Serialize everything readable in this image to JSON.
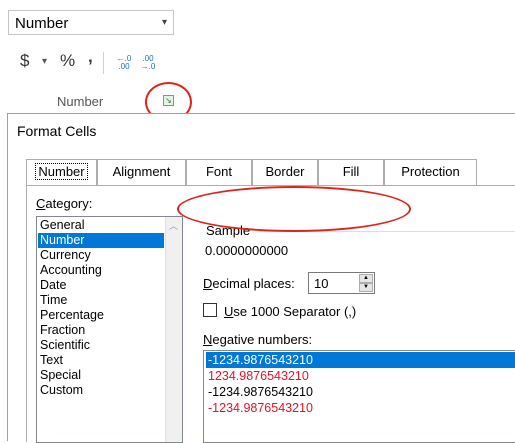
{
  "ribbon": {
    "number_format_value": "Number",
    "currency_symbol": "$",
    "percent_symbol": "%",
    "comma_symbol": ",",
    "increase_decimal_top": "←.0",
    "increase_decimal_bottom": ".00",
    "decrease_decimal_top": ".00",
    "decrease_decimal_bottom": "→.0",
    "group_label": "Number",
    "launcher_icon": "dialog-launcher-icon"
  },
  "dialog": {
    "title": "Format Cells",
    "tabs": [
      "Number",
      "Alignment",
      "Font",
      "Border",
      "Fill",
      "Protection"
    ],
    "active_tab": "Number",
    "category_label_u": "C",
    "category_label_rest": "ategory:",
    "categories": [
      "General",
      "Number",
      "Currency",
      "Accounting",
      "Date",
      "Time",
      "Percentage",
      "Fraction",
      "Scientific",
      "Text",
      "Special",
      "Custom"
    ],
    "selected_category": "Number",
    "sample_label": "Sample",
    "sample_value": "0.0000000000",
    "decimal_label_u": "D",
    "decimal_label_rest": "ecimal places:",
    "decimal_places": "10",
    "use_separator_label_u": "U",
    "use_separator_label_rest": "se 1000 Separator (,)",
    "use_separator_checked": false,
    "negative_label_u": "N",
    "negative_label_rest": "egative numbers:",
    "negative_options": [
      "-1234.9876543210",
      "1234.9876543210",
      "-1234.9876543210",
      "-1234.9876543210"
    ]
  },
  "colors": {
    "selection": "#0078d7",
    "negative_red": "#e81123",
    "annotation_red": "#e0241b"
  }
}
